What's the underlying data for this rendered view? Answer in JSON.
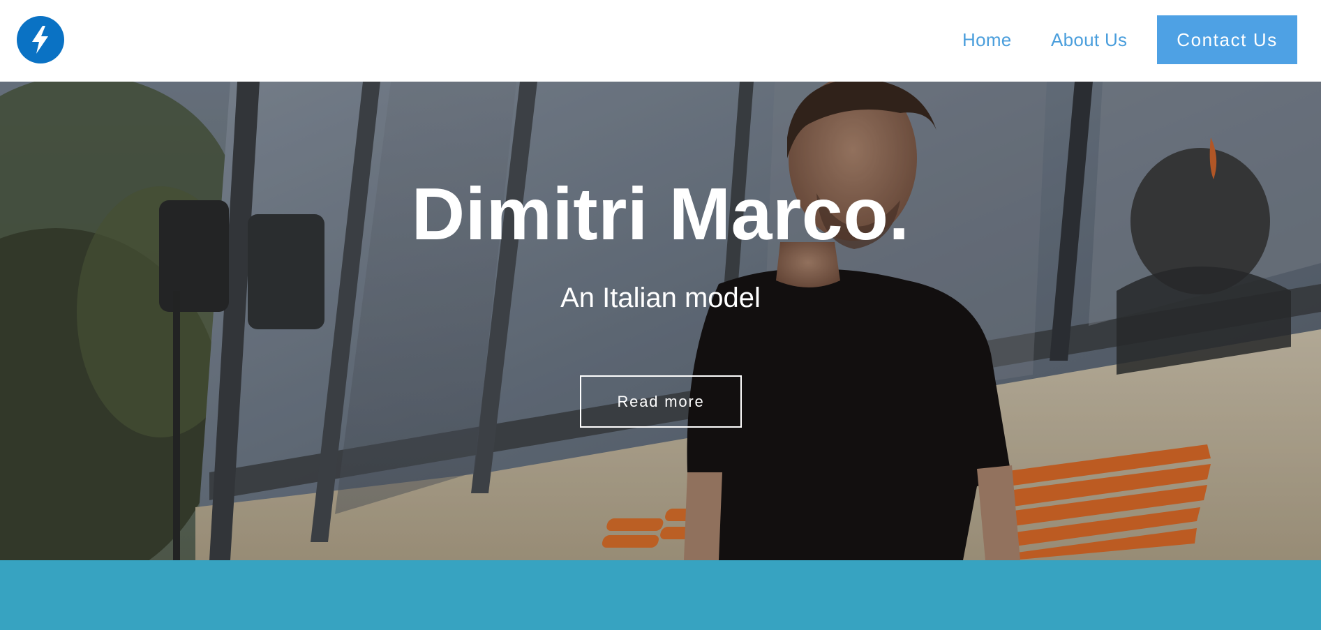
{
  "header": {
    "logo_icon": "lightning-bolt-icon",
    "nav": {
      "home": "Home",
      "about": "About Us",
      "contact": "Contact Us"
    }
  },
  "hero": {
    "title": "Dimitri Marco.",
    "subtitle": "An Italian model",
    "cta": "Read more"
  },
  "colors": {
    "logo_bg": "#0a72c4",
    "nav_link": "#4a9edc",
    "contact_bg": "#4ea1e4",
    "band": "#37a3c1"
  }
}
